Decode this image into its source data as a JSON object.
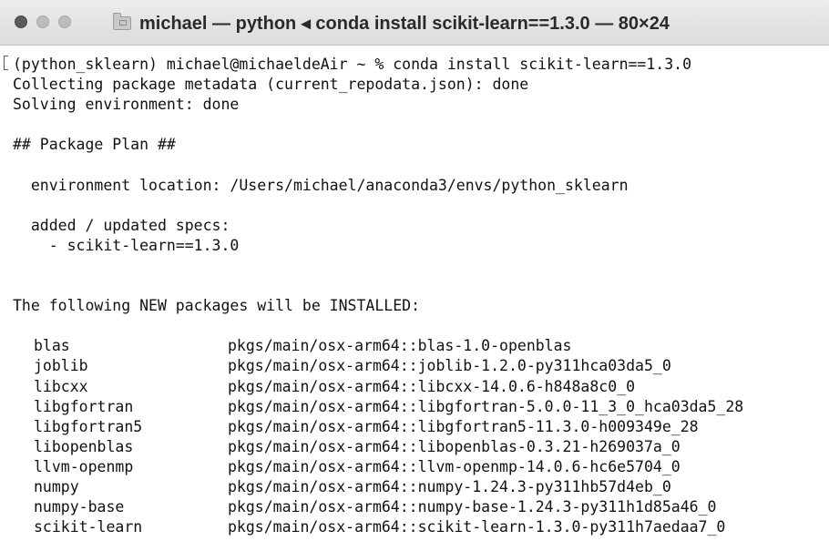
{
  "window": {
    "title": "michael — python ◂ conda install scikit-learn==1.3.0 — 80×24",
    "traffic_lights": [
      "close",
      "minimize",
      "zoom"
    ],
    "title_icon": "folder-icon"
  },
  "terminal": {
    "lines": [
      "(python_sklearn) michael@michaeldeAir ~ % conda install scikit-learn==1.3.0",
      "Collecting package metadata (current_repodata.json): done",
      "Solving environment: done",
      "",
      "## Package Plan ##",
      "",
      "  environment location: /Users/michael/anaconda3/envs/python_sklearn",
      "",
      "  added / updated specs:",
      "    - scikit-learn==1.3.0",
      "",
      "",
      "The following NEW packages will be INSTALLED:",
      ""
    ],
    "packages": [
      {
        "name": "blas",
        "source": "pkgs/main/osx-arm64::blas-1.0-openblas"
      },
      {
        "name": "joblib",
        "source": "pkgs/main/osx-arm64::joblib-1.2.0-py311hca03da5_0"
      },
      {
        "name": "libcxx",
        "source": "pkgs/main/osx-arm64::libcxx-14.0.6-h848a8c0_0"
      },
      {
        "name": "libgfortran",
        "source": "pkgs/main/osx-arm64::libgfortran-5.0.0-11_3_0_hca03da5_28"
      },
      {
        "name": "libgfortran5",
        "source": "pkgs/main/osx-arm64::libgfortran5-11.3.0-h009349e_28"
      },
      {
        "name": "libopenblas",
        "source": "pkgs/main/osx-arm64::libopenblas-0.3.21-h269037a_0"
      },
      {
        "name": "llvm-openmp",
        "source": "pkgs/main/osx-arm64::llvm-openmp-14.0.6-hc6e5704_0"
      },
      {
        "name": "numpy",
        "source": "pkgs/main/osx-arm64::numpy-1.24.3-py311hb57d4eb_0"
      },
      {
        "name": "numpy-base",
        "source": "pkgs/main/osx-arm64::numpy-base-1.24.3-py311h1d85a46_0"
      },
      {
        "name": "scikit-learn",
        "source": "pkgs/main/osx-arm64::scikit-learn-1.3.0-py311h7aedaa7_0"
      }
    ]
  }
}
